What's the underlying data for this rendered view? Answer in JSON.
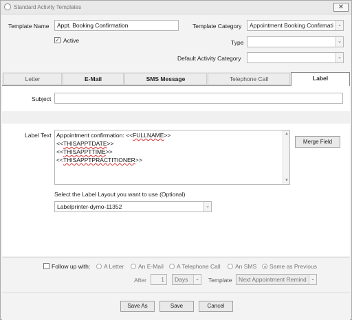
{
  "window": {
    "title": "Standard Activity Templates",
    "close_label": "✕"
  },
  "header": {
    "template_name_label": "Template Name",
    "template_name_value": "Appt. Booking Confirmation",
    "active_label": "Active",
    "active_checked": true,
    "template_category_label": "Template Category",
    "template_category_value": "Appointment Booking Confirmati",
    "type_label": "Type",
    "type_value": "",
    "default_activity_category_label": "Default Activity Category",
    "default_activity_category_value": ""
  },
  "tabs": [
    {
      "label": "Letter"
    },
    {
      "label": "E-Mail"
    },
    {
      "label": "SMS Message"
    },
    {
      "label": "Telephone Call"
    },
    {
      "label": "Label"
    }
  ],
  "active_tab": "Label",
  "label_tab": {
    "subject_label": "Subject",
    "subject_value": "",
    "label_text_label": "Label Text",
    "label_text_lines": [
      {
        "prefix": "Appointment confirmation: <<",
        "token": "FULLNAME",
        "suffix": ">>"
      },
      {
        "prefix": "<<",
        "token": "THISAPPTDATE",
        "suffix": ">>"
      },
      {
        "prefix": "<<",
        "token": "THISAPPTTIME",
        "suffix": ">>"
      },
      {
        "prefix": "<<",
        "token": "THISAPPTPRACTITIONER",
        "suffix": ">>"
      }
    ],
    "merge_field_button": "Merge Field",
    "layout_prompt": "Select the Label Layout you want to use (Optional)",
    "layout_value": "Labelprinter-dymo-11352"
  },
  "follow_up": {
    "checkbox_label": "Follow up with:",
    "checked": false,
    "options": [
      {
        "label": "A Letter",
        "selected": false
      },
      {
        "label": "An E-Mail",
        "selected": false
      },
      {
        "label": "A Telephone Call",
        "selected": false
      },
      {
        "label": "An SMS",
        "selected": false
      },
      {
        "label": "Same as Previous",
        "selected": true
      }
    ],
    "after_label": "After",
    "after_value": "1",
    "unit_value": "Days",
    "template_label": "Template",
    "template_value": "Next Appointment Remind"
  },
  "footer": {
    "save_as_label": "Save As",
    "save_label": "Save",
    "cancel_label": "Cancel"
  },
  "icons": {
    "dropdown_arrow": "⌄",
    "check_mark": "✓",
    "scroll_up": "▲",
    "scroll_down": "▼"
  }
}
